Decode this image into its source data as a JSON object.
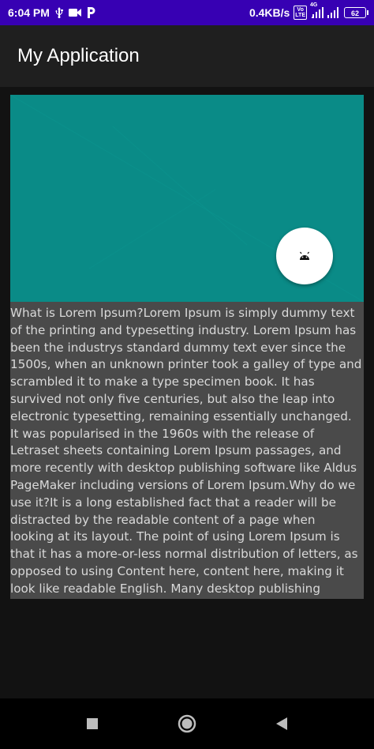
{
  "status_bar": {
    "time": "6:04 PM",
    "network_speed": "0.4KB/s",
    "network_type": "4G",
    "battery": "62",
    "icons": [
      "usb-icon",
      "video-icon",
      "parking-icon",
      "volte-icon",
      "signal-icon",
      "battery-icon"
    ]
  },
  "app_bar": {
    "title": "My Application"
  },
  "card": {
    "image_color": "#0a8b87",
    "fab_icon": "android-icon"
  },
  "content": {
    "text": "What is Lorem Ipsum?Lorem Ipsum is simply dummy text of the printing and typesetting industry. Lorem Ipsum has been the industrys standard dummy text ever since the 1500s, when an unknown printer took a galley of type and scrambled it to make a type specimen book. It has survived not only five centuries, but also the leap into electronic typesetting, remaining essentially unchanged. It was popularised in the 1960s with the release of Letraset sheets containing Lorem Ipsum passages, and more recently with desktop publishing software like Aldus PageMaker including versions of Lorem Ipsum.Why do we use it?It is a long established fact that a reader will be distracted by the readable content of a page when looking at its layout. The point of using Lorem Ipsum is that it has a more-or-less normal distribution of letters, as opposed to using Content here, content here, making it look like readable English. Many desktop publishing packages"
  },
  "nav_bar": {
    "buttons": [
      "recents-button",
      "home-button",
      "back-button"
    ]
  },
  "colors": {
    "status_bar": "#3700b3",
    "app_bar": "#1f1f1f",
    "background": "#121212",
    "text_panel": "#4a4a4a"
  }
}
